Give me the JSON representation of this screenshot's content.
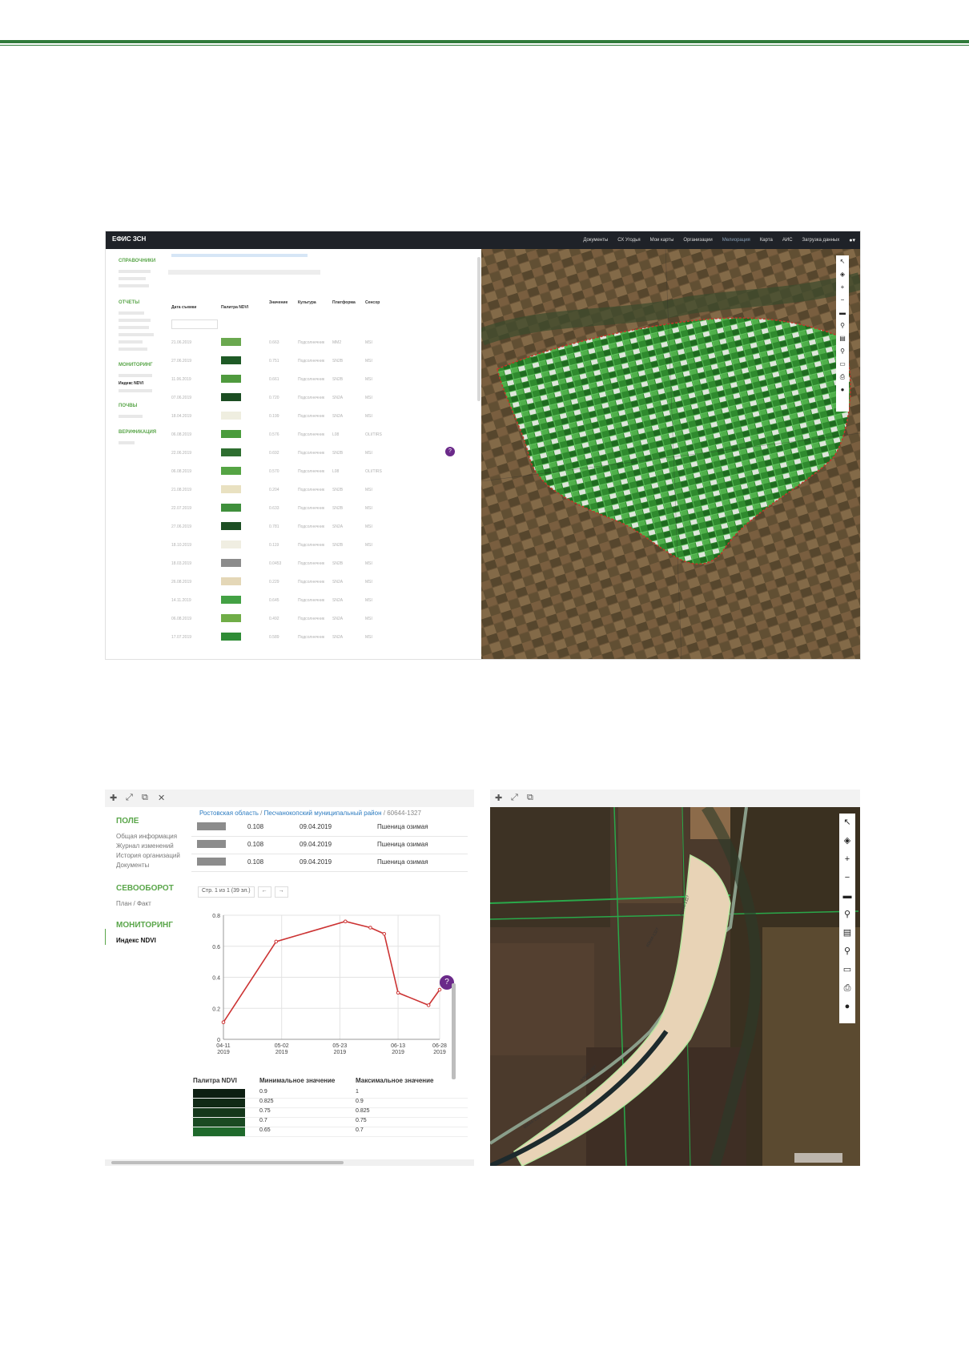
{
  "header_rule_color": "#2f7a3a",
  "shot1": {
    "app_title": "ЕФИС ЗСН",
    "nav": [
      "Документы",
      "СХ Угодья",
      "Мои карты",
      "Организации",
      "Мелиорация",
      "Карта",
      "АИС",
      "Загрузка данных"
    ],
    "nav_active": "Мелиорация",
    "sidebar": {
      "sections": [
        {
          "title": "СПРАВОЧНИКИ",
          "items": [
            "",
            "",
            ""
          ]
        },
        {
          "title": "ОТЧЕТЫ",
          "items": [
            "",
            "",
            "",
            "",
            "",
            ""
          ]
        },
        {
          "title": "МОНИТОРИНГ",
          "items": [
            "",
            "Индекс NDVI",
            ""
          ]
        },
        {
          "title": "ПОЧВЫ",
          "items": [
            ""
          ]
        },
        {
          "title": "ВЕРИФИКАЦИЯ",
          "items": [
            ""
          ]
        }
      ]
    },
    "table": {
      "headers": [
        "Дата съемки",
        "Палитра NDVI",
        "Значение",
        "Культура",
        "Платформа",
        "Сенсор"
      ],
      "rows": [
        {
          "date": "21.06.2019",
          "color": "#6aa84f",
          "value": "0.663",
          "culture": "Подсолнечник",
          "platform": "MM2",
          "sensor": "MSI"
        },
        {
          "date": "27.06.2019",
          "color": "#1e5a26",
          "value": "0.751",
          "culture": "Подсолнечник",
          "platform": "SN2B",
          "sensor": "MSI"
        },
        {
          "date": "11.06.2019",
          "color": "#4f9a3e",
          "value": "0.661",
          "culture": "Подсолнечник",
          "platform": "SN2B",
          "sensor": "MSI"
        },
        {
          "date": "07.06.2019",
          "color": "#1b4d22",
          "value": "0.720",
          "culture": "Подсолнечник",
          "platform": "SN2A",
          "sensor": "MSI"
        },
        {
          "date": "18.04.2019",
          "color": "#efeee0",
          "value": "0.199",
          "culture": "Подсолнечник",
          "platform": "SN2A",
          "sensor": "MSI"
        },
        {
          "date": "06.08.2019",
          "color": "#4a9c3c",
          "value": "0.576",
          "culture": "Подсолнечник",
          "platform": "L08",
          "sensor": "OLI/TIRS"
        },
        {
          "date": "22.06.2019",
          "color": "#2e6e30",
          "value": "0.692",
          "culture": "Подсолнечник",
          "platform": "SN2B",
          "sensor": "MSI"
        },
        {
          "date": "06.08.2019",
          "color": "#55a444",
          "value": "0.570",
          "culture": "Подсолнечник",
          "platform": "L08",
          "sensor": "OLI/TIRS"
        },
        {
          "date": "21.08.2019",
          "color": "#e9e1c1",
          "value": "0.204",
          "culture": "Подсолнечник",
          "platform": "SN2B",
          "sensor": "MSI"
        },
        {
          "date": "22.07.2019",
          "color": "#3f8f3c",
          "value": "0.633",
          "culture": "Подсолнечник",
          "platform": "SN2B",
          "sensor": "MSI"
        },
        {
          "date": "27.06.2019",
          "color": "#1d4f24",
          "value": "0.781",
          "culture": "Подсолнечник",
          "platform": "SN2A",
          "sensor": "MSI"
        },
        {
          "date": "18.10.2019",
          "color": "#f0eee2",
          "value": "0.119",
          "culture": "Подсолнечник",
          "platform": "SN2B",
          "sensor": "MSI"
        },
        {
          "date": "18.03.2019",
          "color": "#8c8c8c",
          "value": "0.0453",
          "culture": "Подсолнечник",
          "platform": "SN2B",
          "sensor": "MSI"
        },
        {
          "date": "26.08.2019",
          "color": "#e4d7b7",
          "value": "0.229",
          "culture": "Подсолнечник",
          "platform": "SN2A",
          "sensor": "MSI"
        },
        {
          "date": "14.11.2019",
          "color": "#43a144",
          "value": "0.645",
          "culture": "Подсолнечник",
          "platform": "SN2A",
          "sensor": "MSI"
        },
        {
          "date": "06.08.2019",
          "color": "#70ad47",
          "value": "0.492",
          "culture": "Подсолнечник",
          "platform": "SN2A",
          "sensor": "MSI"
        },
        {
          "date": "17.07.2019",
          "color": "#2f8c36",
          "value": "0.589",
          "culture": "Подсолнечник",
          "platform": "SN2A",
          "sensor": "MSI"
        }
      ]
    },
    "map_toolbar_icons": [
      "cursor-icon",
      "layers-icon",
      "zoom-in-icon",
      "zoom-out-icon",
      "ruler-icon",
      "pin-icon",
      "measure-icon",
      "search-icon",
      "folder-icon",
      "print-icon",
      "location-icon"
    ],
    "help_badge": "?"
  },
  "shot2": {
    "window_icons": [
      "move-icon",
      "expand-icon",
      "popout-icon",
      "close-icon"
    ],
    "sidebar": [
      {
        "title": "ПОЛЕ",
        "items": [
          "Общая информация",
          "Журнал изменений",
          "История организаций",
          "Документы"
        ]
      },
      {
        "title": "СЕВООБОРОТ",
        "items": [
          "План / Факт"
        ]
      },
      {
        "title": "МОНИТОРИНГ",
        "items": [
          "Индекс NDVI"
        ]
      }
    ],
    "breadcrumb": {
      "region": "Ростовская область",
      "district": "Песчанокопский муниципальный район",
      "field": "60644-1327",
      "separator": "/"
    },
    "rows": [
      {
        "value": "0.108",
        "date": "09.04.2019",
        "culture": "Пшеница озимая"
      },
      {
        "value": "0.108",
        "date": "09.04.2019",
        "culture": "Пшеница озимая"
      },
      {
        "value": "0.108",
        "date": "09.04.2019",
        "culture": "Пшеница озимая"
      }
    ],
    "pager": {
      "text": "Стр. 1 из 1 (39 эл.)",
      "prev": "←",
      "next": "→"
    },
    "help_badge": "?",
    "palette_table": {
      "headers": [
        "Палитра NDVI",
        "Минимальное значение",
        "Максимальное значение"
      ],
      "rows": [
        {
          "color": "#0d1f12",
          "min": "0.9",
          "max": "1"
        },
        {
          "color": "#112a16",
          "min": "0.825",
          "max": "0.9"
        },
        {
          "color": "#15381b",
          "min": "0.75",
          "max": "0.825"
        },
        {
          "color": "#1a4a22",
          "min": "0.7",
          "max": "0.75"
        },
        {
          "color": "#1f6a2c",
          "min": "0.65",
          "max": "0.7"
        }
      ]
    },
    "map_toolbar_icons": [
      "cursor-icon",
      "layers-icon",
      "zoom-in-icon",
      "zoom-out-icon",
      "ruler-icon",
      "pin-icon",
      "measure-icon",
      "search-icon",
      "folder-icon",
      "print-icon",
      "location-icon"
    ],
    "parcel_labels": [
      "60644-1327",
      "60644-1327",
      "60644-1327",
      "60644-1327"
    ]
  },
  "chart_data": {
    "type": "line",
    "x": [
      "2019-04-11",
      "2019-04-30",
      "2019-05-25",
      "2019-06-03",
      "2019-06-08",
      "2019-06-13",
      "2019-06-24",
      "2019-06-28"
    ],
    "series": [
      {
        "values": [
          0.11,
          0.63,
          0.76,
          0.72,
          0.68,
          0.3,
          0.22,
          0.32
        ]
      }
    ],
    "xticks": [
      {
        "top": "04-11",
        "bottom": "2019"
      },
      {
        "top": "05-02",
        "bottom": "2019"
      },
      {
        "top": "05-23",
        "bottom": "2019"
      },
      {
        "top": "06-13",
        "bottom": "2019"
      },
      {
        "top": "06-28",
        "bottom": "2019"
      }
    ],
    "yticks": [
      "0",
      "0.2",
      "0.4",
      "0.6",
      "0.8"
    ],
    "ylim": [
      0,
      0.8
    ],
    "grid": true,
    "line_color": "#cc3333"
  }
}
